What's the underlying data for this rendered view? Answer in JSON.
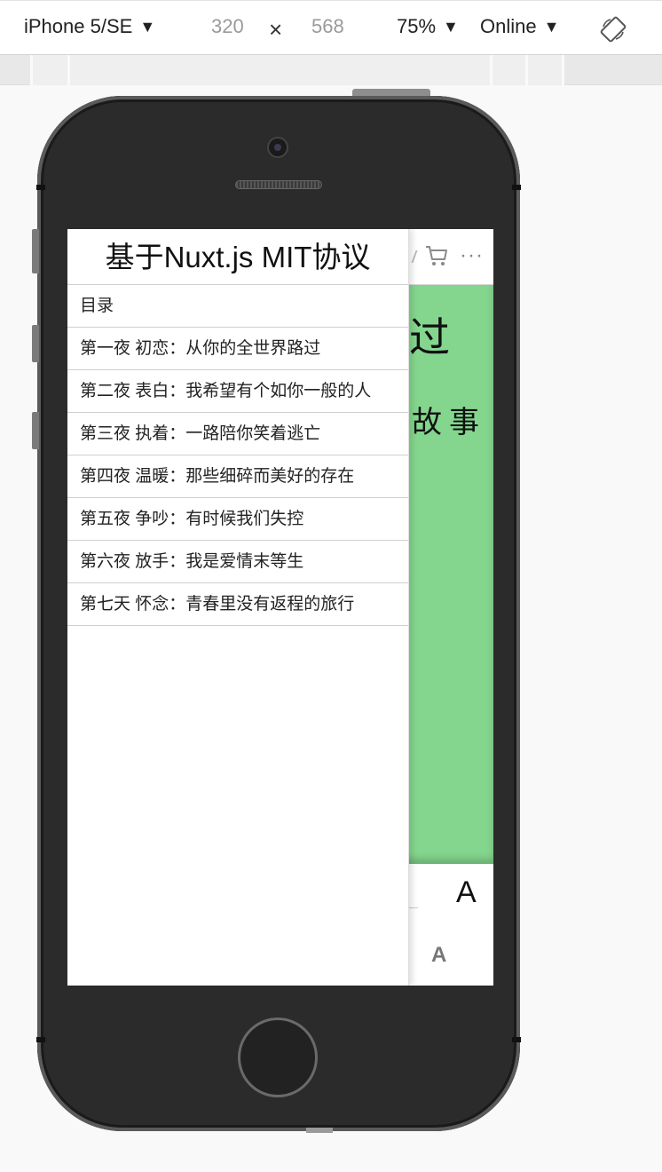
{
  "devtools": {
    "device": "iPhone 5/SE",
    "width": "320",
    "times": "×",
    "height": "568",
    "zoom": "75%",
    "network": "Online",
    "arrow": "▼"
  },
  "page": {
    "header_more": "···",
    "story_title_fragment": "过",
    "story_subtitle_fragment": "故事",
    "font_large": "A",
    "font_small": "A"
  },
  "drawer": {
    "title": "基于Nuxt.js MIT协议",
    "toc_label": "目录",
    "chapters": [
      "第一夜 初恋：从你的全世界路过",
      "第二夜 表白：我希望有个如你一般的人",
      "第三夜 执着：一路陪你笑着逃亡",
      "第四夜 温暖：那些细碎而美好的存在",
      "第五夜 争吵：有时候我们失控",
      "第六夜 放手：我是爱情末等生",
      "第七天 怀念：青春里没有返程的旅行"
    ]
  },
  "colors": {
    "green_background": "#84d68e",
    "phone_body": "#2b2b2b"
  }
}
